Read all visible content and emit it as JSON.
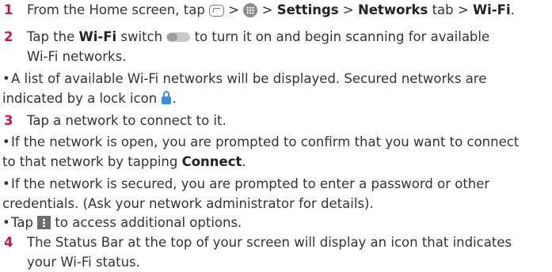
{
  "step1": {
    "number": "1",
    "text_a": "From the Home screen, tap ",
    "sep1": " > ",
    "sep2": " > ",
    "settings": "Settings",
    "sep3": " > ",
    "networks": "Networks",
    "tab_text": " tab > ",
    "wifi": "Wi-Fi",
    "end": ".",
    "icons": [
      "home-key-icon",
      "apps-icon"
    ]
  },
  "step2": {
    "number": "2",
    "text_a": "Tap the ",
    "wifi": "Wi-Fi",
    "text_b": " switch ",
    "text_c": " to turn it on and begin scanning for available",
    "line2": "Wi-Fi networks.",
    "icons": [
      "wifi-switch-icon"
    ]
  },
  "bullet_list": {
    "line1": "A list of available Wi-Fi networks will be displayed. Secured networks are",
    "line2a": "indicated by a lock icon ",
    "line2b": ".",
    "lock_color": "#3f8edc"
  },
  "step3": {
    "number": "3",
    "text": "Tap a network to connect to it."
  },
  "bullet_open": {
    "line1": "If the network is open, you are prompted to confirm that you want to connect",
    "line2a": "to that network by tapping ",
    "connect": "Connect",
    "line2b": "."
  },
  "bullet_secured": {
    "line1": "If the network is secured, you are prompted to enter a password or other",
    "line2": "credentials. (Ask your network administrator for details)."
  },
  "bullet_tap": {
    "text_a": "Tap ",
    "text_b": " to access additional options."
  },
  "step4": {
    "number": "4",
    "line1": "The Status Bar at the top of your screen will display an icon that  indicates",
    "line2": "your Wi-Fi status."
  },
  "bullet_char": "•",
  "accent_color": "#c3164e"
}
